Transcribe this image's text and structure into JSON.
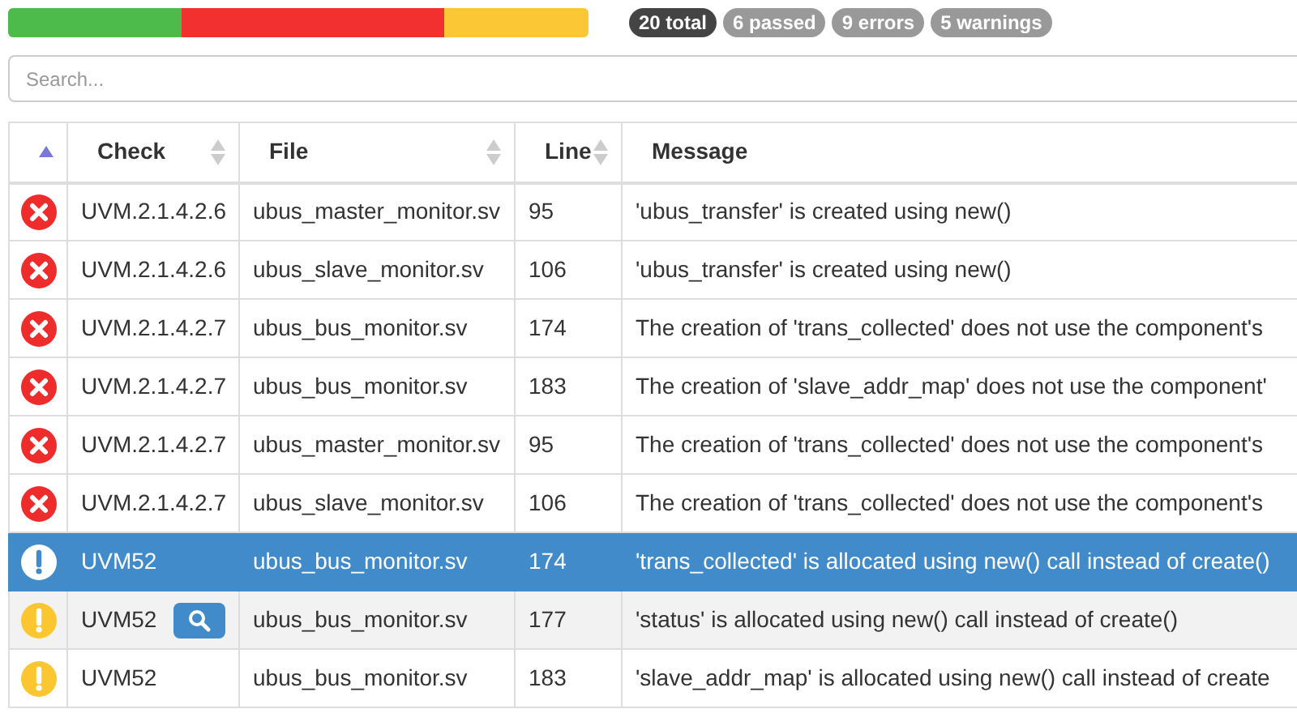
{
  "summary_bar": [
    {
      "kind": "passed",
      "level": 0.3
    },
    {
      "kind": "errors"
    },
    {
      "kind": "warnings",
      "level": 0.25
    }
  ],
  "badges": [
    {
      "label": "20 total",
      "selected": true
    },
    {
      "label": "6 passed",
      "selected": false
    },
    {
      "label": "9 errors",
      "selected": false
    },
    {
      "label": "5 warnings",
      "selected": false
    }
  ],
  "search": {
    "placeholder": "Search..."
  },
  "table": {
    "columns": [
      {
        "sorted": true
      },
      {
        "label": "Check",
        "sorted": false
      },
      {
        "label": "File",
        "sorted": false
      },
      {
        "label": "Line",
        "sorted": false
      },
      {
        "label": "Message"
      }
    ],
    "rows": [
      {
        "kind": "error",
        "check": "UVM.2.1.4.2.6",
        "file": "ubus_master_monitor.sv",
        "line": "95",
        "message": "'ubus_transfer' is created using new()",
        "selected": false,
        "hovered": false
      },
      {
        "kind": "error",
        "check": "UVM.2.1.4.2.6",
        "file": "ubus_slave_monitor.sv",
        "line": "106",
        "message": "'ubus_transfer' is created using new()",
        "selected": false,
        "hovered": false
      },
      {
        "kind": "error",
        "check": "UVM.2.1.4.2.7",
        "file": "ubus_bus_monitor.sv",
        "line": "174",
        "message": "The creation of 'trans_collected' does not use the component's",
        "selected": false,
        "hovered": false
      },
      {
        "kind": "error",
        "check": "UVM.2.1.4.2.7",
        "file": "ubus_bus_monitor.sv",
        "line": "183",
        "message": "The creation of 'slave_addr_map' does not use the component'",
        "selected": false,
        "hovered": false
      },
      {
        "kind": "error",
        "check": "UVM.2.1.4.2.7",
        "file": "ubus_master_monitor.sv",
        "line": "95",
        "message": "The creation of 'trans_collected' does not use the component's",
        "selected": false,
        "hovered": false
      },
      {
        "kind": "error",
        "check": "UVM.2.1.4.2.7",
        "file": "ubus_slave_monitor.sv",
        "line": "106",
        "message": "The creation of 'trans_collected' does not use the component's",
        "selected": false,
        "hovered": false
      },
      {
        "kind": "warning",
        "check": "UVM52",
        "file": "ubus_bus_monitor.sv",
        "line": "174",
        "message": "'trans_collected' is allocated using new() call instead of create()",
        "selected": true,
        "hovered": false
      },
      {
        "kind": "warning",
        "check": "UVM52",
        "file": "ubus_bus_monitor.sv",
        "line": "177",
        "message": "'status' is allocated using new() call instead of create()",
        "selected": false,
        "hovered": true
      },
      {
        "kind": "warning",
        "check": "UVM52",
        "file": "ubus_bus_monitor.sv",
        "line": "183",
        "message": "'slave_addr_map' is allocated using new() call instead of create",
        "selected": false,
        "hovered": false
      }
    ]
  }
}
